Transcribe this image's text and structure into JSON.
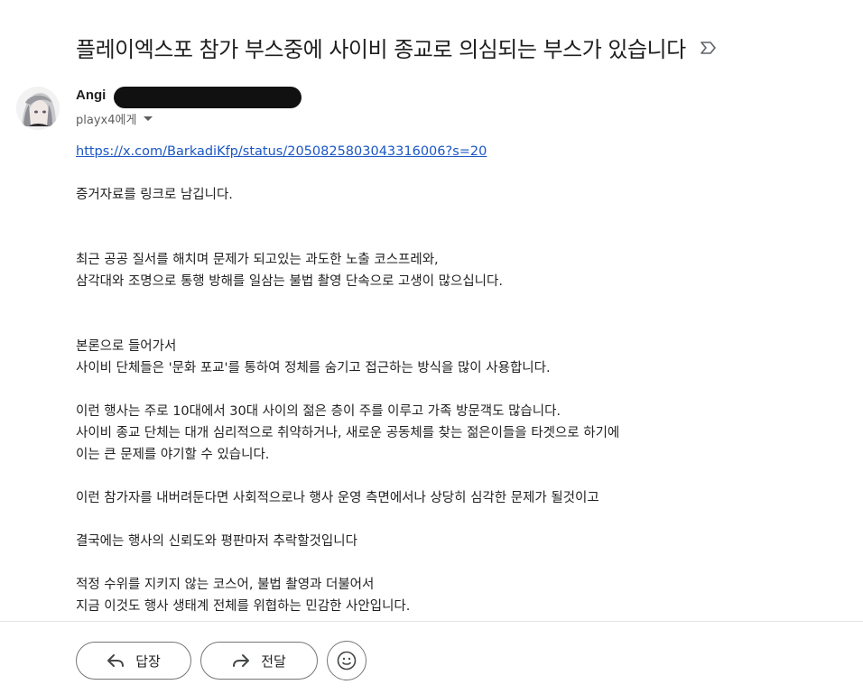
{
  "email": {
    "subject": "플레이엑스포 참가 부스중에 사이비 종교로 의심되는 부스가 있습니다",
    "sender_name": "Angi",
    "recipient": "playx4에게"
  },
  "body": {
    "link": "https://x.com/BarkadiKfp/status/2050825803043316006?s=20",
    "p1": "증거자료를 링크로 남깁니다.",
    "p2_l1": "최근 공공 질서를 해치며 문제가 되고있는 과도한 노출 코스프레와,",
    "p2_l2": "삼각대와 조명으로 통행 방해를 일삼는 불법 촬영 단속으로 고생이 많으십니다.",
    "p3_l1": "본론으로 들어가서",
    "p3_l2": "사이비 단체들은 '문화 포교'를 통하여 정체를 숨기고 접근하는 방식을 많이 사용합니다.",
    "p4_l1": "이런 행사는 주로 10대에서 30대 사이의 젊은 층이 주를 이루고 가족 방문객도 많습니다.",
    "p4_l2": "사이비 종교 단체는 대개 심리적으로 취약하거나, 새로운 공동체를 찾는 젊은이들을 타겟으로 하기에",
    "p4_l3": "이는 큰 문제를 야기할 수 있습니다.",
    "p5": "이런 참가자를 내버려둔다면 사회적으로나 행사 운영 측면에서나 상당히 심각한 문제가 될것이고",
    "p6": "결국에는 행사의 신뢰도와 평판마저 추락할것입니다",
    "p7_l1": "적정 수위를 지키지 않는 코스어, 불법 촬영과 더불어서",
    "p7_l2": "지금 이것도 행사 생태계 전체를 위협하는 민감한 사안입니다."
  },
  "actions": {
    "reply_label": "답장",
    "forward_label": "전달"
  },
  "icons": {
    "label": "label-importance-icon",
    "reply": "reply-icon",
    "forward": "forward-icon",
    "emoji": "emoji-icon"
  },
  "colors": {
    "link": "#1a56c4",
    "text": "#222222",
    "button_border": "#747775"
  }
}
